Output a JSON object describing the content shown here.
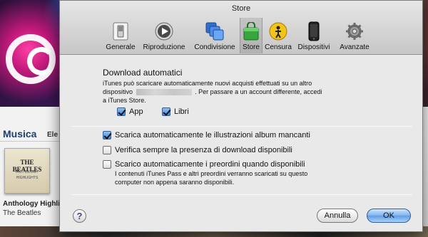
{
  "background": {
    "section_title": "Musica",
    "section_link": "Ele",
    "album_cover_title": "THE BEATLES",
    "album_cover_sub1": "ANTHOLOGY",
    "album_cover_sub2": "HIGHLIGHTS",
    "album_name": "Anthology Highli",
    "album_artist": "The Beatles"
  },
  "dialog": {
    "title": "Store",
    "tabs": [
      {
        "label": "Generale",
        "icon": "switch-icon",
        "selected": false
      },
      {
        "label": "Riproduzione",
        "icon": "play-icon",
        "selected": false
      },
      {
        "label": "Condivisione",
        "icon": "sharing-icon",
        "selected": false
      },
      {
        "label": "Store",
        "icon": "shopping-bag-icon",
        "selected": true
      },
      {
        "label": "Censura",
        "icon": "parental-icon",
        "selected": false
      },
      {
        "label": "Dispositivi",
        "icon": "iphone-icon",
        "selected": false
      },
      {
        "label": "Avanzate",
        "icon": "gear-icon",
        "selected": false
      }
    ],
    "download_section": {
      "title": "Download automatici",
      "desc_line1": "iTunes può scaricare automaticamente nuovi acquisti effettuati su un altro",
      "desc_line2_pre": "dispositivo",
      "desc_line2_post": ". Per passare a un account differente, accedi",
      "desc_line3": "a  iTunes Store.",
      "app_label": "App",
      "app_checked": true,
      "books_label": "Libri",
      "books_checked": true
    },
    "options": {
      "artwork_label": "Scarica automaticamente le illustrazioni album mancanti",
      "artwork_checked": true,
      "check_downloads_label": "Verifica sempre la presenza di download disponibili",
      "check_downloads_checked": false,
      "preorders_label": "Scarico automaticamente i preordini quando disponibili",
      "preorders_checked": false,
      "preorders_note_line1": "I contenuti iTunes Pass e altri preordini verranno scaricati su questo",
      "preorders_note_line2": "computer non appena saranno disponibili."
    },
    "buttons": {
      "help": "?",
      "cancel": "Annulla",
      "ok": "OK"
    },
    "colors": {
      "accent": "#5f9de6",
      "selected_tab": "#b8b8b8"
    }
  }
}
